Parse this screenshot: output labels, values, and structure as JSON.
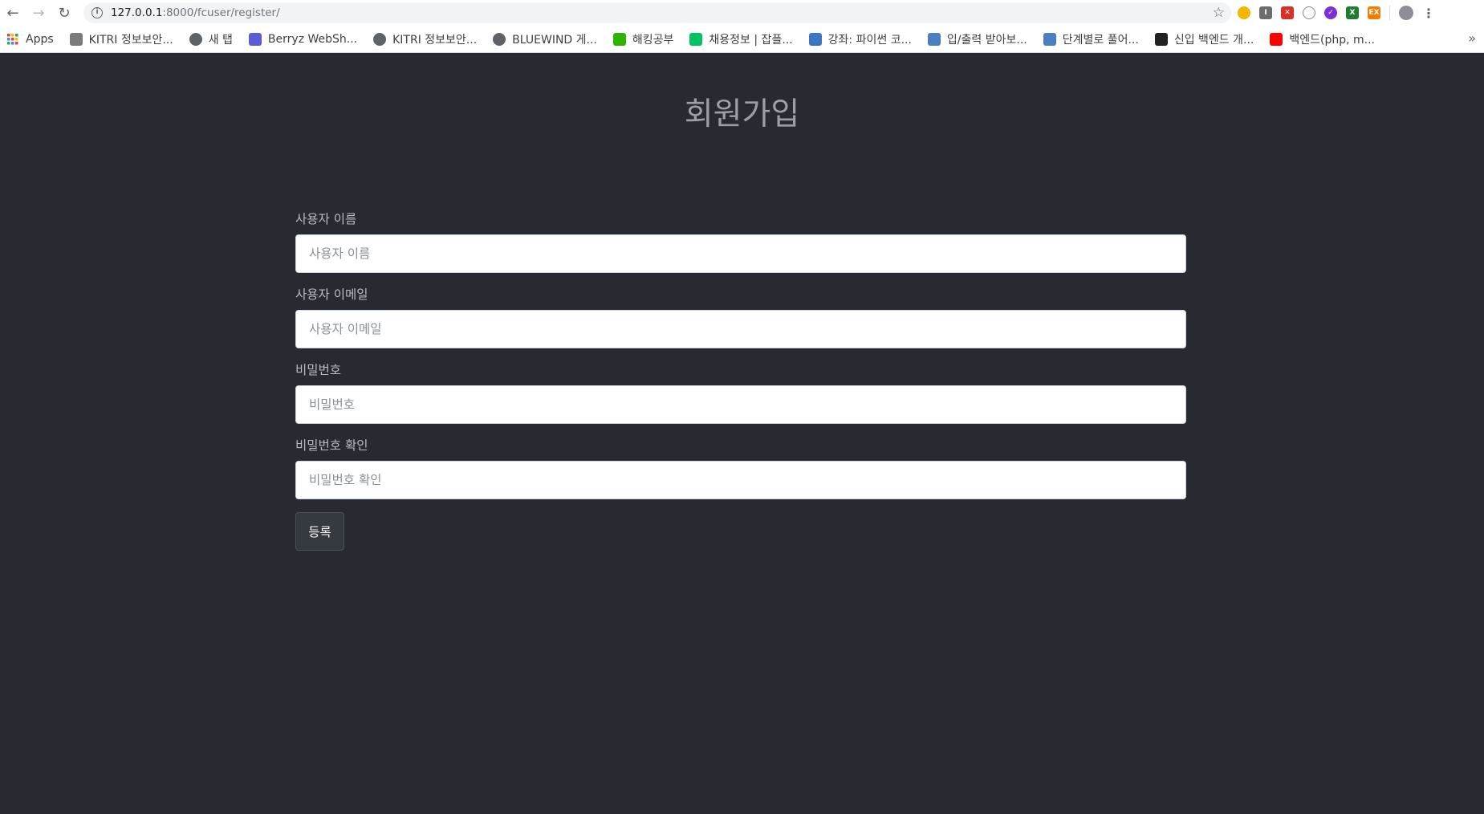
{
  "browser": {
    "url_host": "127.0.0.1",
    "url_path": ":8000/fcuser/register/"
  },
  "bookmarks": [
    {
      "label": "Apps",
      "icon": "apps-grid-icon",
      "color": "#ea4335"
    },
    {
      "label": "KITRI 정보보안...",
      "icon": "kitri-icon",
      "color": "#7b7b7b"
    },
    {
      "label": "새 탭",
      "icon": "globe-icon",
      "color": "#5f6368"
    },
    {
      "label": "Berryz WebSh...",
      "icon": "berryz-icon",
      "color": "#5b5bd6"
    },
    {
      "label": "KITRI 정보보안...",
      "icon": "globe-icon",
      "color": "#5f6368"
    },
    {
      "label": "BLUEWIND 게...",
      "icon": "globe-icon",
      "color": "#5f6368"
    },
    {
      "label": "해킹공부",
      "icon": "naver-blog-icon",
      "color": "#2db400"
    },
    {
      "label": "채용정보 | 잡플...",
      "icon": "jobplanet-icon",
      "color": "#00c362"
    },
    {
      "label": "강좌: 파이썬 코...",
      "icon": "wikidocs-icon",
      "color": "#3b78c4"
    },
    {
      "label": "입/출력 받아보...",
      "icon": "code-icon",
      "color": "#4a7fc1"
    },
    {
      "label": "단계별로 풀어...",
      "icon": "code-icon",
      "color": "#4a7fc1"
    },
    {
      "label": "신입 백엔드 개...",
      "icon": "tistory-icon",
      "color": "#222222"
    },
    {
      "label": "백엔드(php, m...",
      "icon": "youtube-icon",
      "color": "#ff0000"
    }
  ],
  "page": {
    "title": "회원가입",
    "fields": [
      {
        "label": "사용자 이름",
        "placeholder": "사용자 이름"
      },
      {
        "label": "사용자 이메일",
        "placeholder": "사용자 이메일"
      },
      {
        "label": "비밀번호",
        "placeholder": "비밀번호"
      },
      {
        "label": "비밀번호 확인",
        "placeholder": "비밀번호 확인"
      }
    ],
    "submit_label": "등록"
  }
}
